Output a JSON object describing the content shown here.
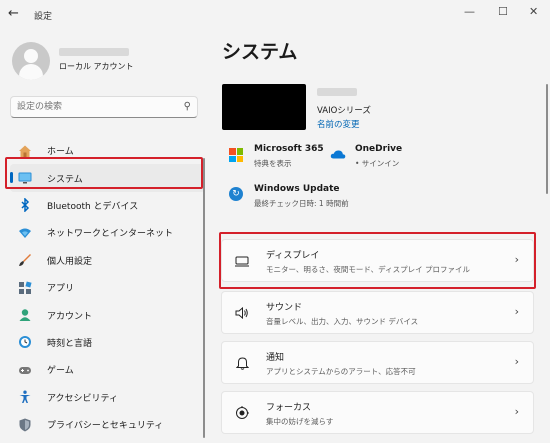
{
  "window": {
    "title": "設定",
    "back_icon": "back-arrow-icon",
    "controls": [
      "minimize-icon",
      "maximize-icon",
      "close-icon"
    ]
  },
  "profile": {
    "account_type": "ローカル アカウント"
  },
  "search": {
    "placeholder": "設定の検索",
    "icon": "search-icon"
  },
  "sidebar": {
    "selected": "システム",
    "items": [
      {
        "label": "ホーム",
        "icon": "home-icon"
      },
      {
        "label": "システム",
        "icon": "system-display-icon"
      },
      {
        "label": "Bluetooth とデバイス",
        "icon": "bluetooth-icon"
      },
      {
        "label": "ネットワークとインターネット",
        "icon": "wifi-icon"
      },
      {
        "label": "個人用設定",
        "icon": "brush-icon"
      },
      {
        "label": "アプリ",
        "icon": "apps-icon"
      },
      {
        "label": "アカウント",
        "icon": "account-icon"
      },
      {
        "label": "時刻と言語",
        "icon": "time-language-icon"
      },
      {
        "label": "ゲーム",
        "icon": "gaming-icon"
      },
      {
        "label": "アクセシビリティ",
        "icon": "accessibility-icon"
      },
      {
        "label": "プライバシーとセキュリティ",
        "icon": "shield-icon"
      }
    ]
  },
  "main": {
    "title": "システム",
    "device": {
      "model": "VAIOシリーズ",
      "rename_link": "名前の変更"
    },
    "microsoft365": {
      "title": "Microsoft 365",
      "subtitle": "特典を表示"
    },
    "onedrive": {
      "title": "OneDrive",
      "subtitle": "• サインイン"
    },
    "windows_update": {
      "title": "Windows Update",
      "subtitle": "最終チェック日時: 1 時間前"
    },
    "cards": [
      {
        "title": "ディスプレイ",
        "subtitle": "モニター、明るさ、夜間モード、ディスプレイ プロファイル",
        "icon": "monitor-icon"
      },
      {
        "title": "サウンド",
        "subtitle": "音量レベル、出力、入力、サウンド デバイス",
        "icon": "speaker-icon"
      },
      {
        "title": "通知",
        "subtitle": "アプリとシステムからのアラート、応答不可",
        "icon": "bell-icon"
      },
      {
        "title": "フォーカス",
        "subtitle": "集中の妨げを減らす",
        "icon": "focus-icon"
      }
    ]
  },
  "colors": {
    "accent": "#0067c0",
    "highlight_box": "#d4202a",
    "background": "#f3f3f3"
  }
}
